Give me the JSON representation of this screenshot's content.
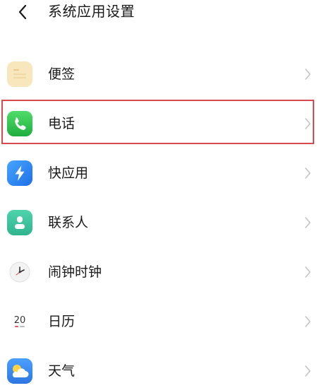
{
  "header": {
    "title": "系统应用设置",
    "back_icon": "chevron-left-icon"
  },
  "list": {
    "items": [
      {
        "label": "便签",
        "icon": "notes-icon",
        "icon_color": "#f7e3b5"
      },
      {
        "label": "电话",
        "icon": "phone-icon",
        "icon_color": "#27c04a",
        "selected": true
      },
      {
        "label": "快应用",
        "icon": "lightning-icon",
        "icon_color": "#2f8cf5"
      },
      {
        "label": "联系人",
        "icon": "contacts-icon",
        "icon_color": "#3fc6a0"
      },
      {
        "label": "闹钟时钟",
        "icon": "clock-icon",
        "icon_color": "#f4f4f4"
      },
      {
        "label": "日历",
        "icon": "calendar-icon",
        "icon_color": "#ffffff",
        "icon_text": "20"
      },
      {
        "label": "天气",
        "icon": "weather-icon",
        "icon_color": "#3d8bf0"
      }
    ],
    "chevron_icon": "chevron-right-icon"
  },
  "colors": {
    "selection_border": "#d94a4f",
    "chevron": "#c4c4c4",
    "text": "#1a1a1a"
  }
}
